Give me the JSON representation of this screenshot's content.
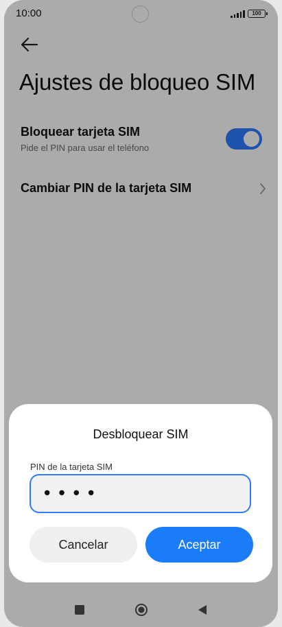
{
  "status_bar": {
    "time": "10:00",
    "battery": "100"
  },
  "header": {
    "back_icon": "arrow-left-icon",
    "title": "Ajustes de bloqueo SIM"
  },
  "settings": {
    "lock_sim": {
      "title": "Bloquear tarjeta SIM",
      "subtitle": "Pide el PIN para usar el teléfono",
      "enabled": true
    },
    "change_pin": {
      "title": "Cambiar PIN de la tarjeta SIM",
      "chevron_icon": "chevron-right-icon"
    }
  },
  "dialog": {
    "title": "Desbloquear SIM",
    "field_label": "PIN de la tarjeta SIM",
    "pin_value": "••••",
    "cancel_label": "Cancelar",
    "accept_label": "Aceptar"
  },
  "nav_bar": {
    "recent_icon": "square-icon",
    "home_icon": "circle-home-icon",
    "back_icon": "triangle-back-icon"
  },
  "colors": {
    "accent": "#1a7cf6",
    "toggle_on": "#2f7bff",
    "overlay": "rgba(0,0,0,0.33)"
  }
}
